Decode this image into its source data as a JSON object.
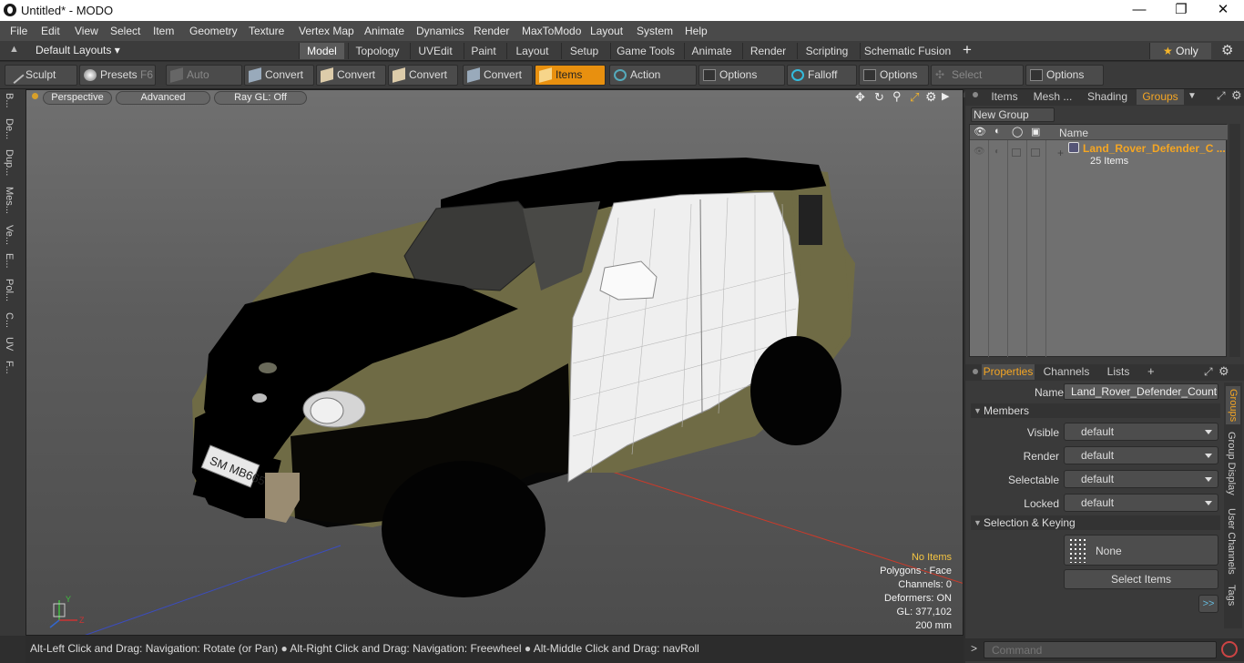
{
  "window": {
    "title": "Untitled* - MODO"
  },
  "menu": [
    "File",
    "Edit",
    "View",
    "Select",
    "Item",
    "Geometry",
    "Texture",
    "Vertex Map",
    "Animate",
    "Dynamics",
    "Render",
    "MaxToModo",
    "Layout",
    "System",
    "Help"
  ],
  "layouts": {
    "dropdown": "Default Layouts",
    "tabs": [
      "Model",
      "Topology",
      "UVEdit",
      "Paint",
      "Layout",
      "Setup",
      "Game Tools",
      "Animate",
      "Render",
      "Scripting",
      "Schematic Fusion"
    ],
    "active": "Model",
    "only_label": "Only"
  },
  "toolbar": {
    "sculpt": "Sculpt",
    "presets": "Presets",
    "presets_key": "F6",
    "auto_select": "Auto Select",
    "convert1": "Convert",
    "convert2": "Convert",
    "convert3": "Convert",
    "convert4": "Convert",
    "items": "Items",
    "action_center": "Action Center",
    "options1": "Options",
    "falloff": "Falloff",
    "options2": "Options",
    "select_through": "Select Through",
    "options3": "Options"
  },
  "left_tabs": [
    "B...",
    "De...",
    "Dup...",
    "Mes...",
    "Ve...",
    "E...",
    "Pol...",
    "C...",
    "UV",
    "F..."
  ],
  "viewport": {
    "perspective": "Perspective",
    "advanced": "Advanced",
    "raygl": "Ray GL: Off",
    "plate": "SM MB665",
    "hud": {
      "items": "No Items",
      "polygons": "Polygons : Face",
      "channels": "Channels: 0",
      "deformers": "Deformers: ON",
      "gl": "GL: 377,102",
      "scale": "200 mm"
    },
    "axis_y": "Y",
    "axis_z": "Z"
  },
  "status": {
    "hint1": "Alt-Left Click and Drag: Navigation: Rotate (or Pan)",
    "hint2": "Alt-Right Click and Drag: Navigation: Freewheel",
    "hint3": "Alt-Middle Click and Drag: navRoll"
  },
  "groups_panel": {
    "tabs": [
      "Items",
      "Mesh ...",
      "Shading",
      "Groups"
    ],
    "active": "Groups",
    "new_group": "New Group",
    "col_name": "Name",
    "group_name": "Land_Rover_Defender_C ...",
    "group_count": "25 Items"
  },
  "properties": {
    "tabs": [
      "Properties",
      "Channels",
      "Lists"
    ],
    "active": "Properties",
    "name_label": "Name",
    "name_value": "Land_Rover_Defender_Country",
    "members_header": "Members",
    "visible_label": "Visible",
    "visible_value": "default",
    "render_label": "Render",
    "render_value": "default",
    "selectable_label": "Selectable",
    "selectable_value": "default",
    "locked_label": "Locked",
    "locked_value": "default",
    "sel_keying_header": "Selection & Keying",
    "none_label": "None",
    "select_items": "Select Items",
    "more": ">>"
  },
  "side_tabs": [
    "Groups",
    "Group Display",
    "User Channels",
    "Tags"
  ],
  "command": {
    "placeholder": "Command"
  }
}
